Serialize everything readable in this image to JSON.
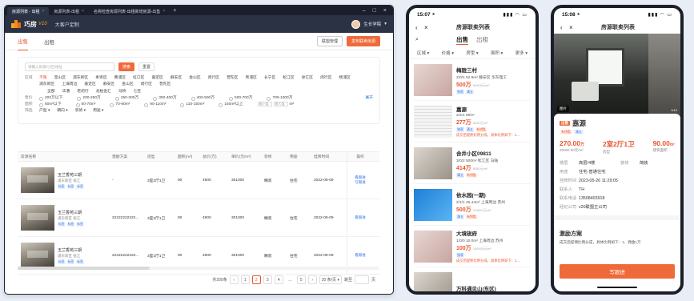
{
  "desktop": {
    "tabs": [
      "房源列表 - 出租",
      "房源列表-出租",
      "名称检查房源列表-出租新增房源-出售"
    ],
    "app_title": "巧房",
    "app_sub": "V10",
    "crumb": "大客户定制",
    "user": "生长学院",
    "page_tabs": [
      "出售",
      "出租"
    ],
    "btn_manage": "联盟管理",
    "btn_publish": "发布联卖房源",
    "search_placeholder": "请输入房源/小区/地址",
    "btn_search": "搜索",
    "btn_reset": "重置",
    "filter_labels": [
      "区域",
      "",
      "",
      "售价",
      "面积",
      "筛选"
    ],
    "districts": [
      "不限",
      "宝山区",
      "浦东新区",
      "奉贤区",
      "黄浦区",
      "虹口区",
      "嘉定区",
      "静安区",
      "金山区",
      "闵行区",
      "普陀区",
      "青浦区",
      "长宁区",
      "松江区",
      "徐汇区",
      "闵行区",
      "杨浦区"
    ],
    "districts2": [
      "浦东新区",
      "上海周边",
      "嘉定区",
      "静安区",
      "金山区",
      "闵行区",
      "普陀区"
    ],
    "sub_areas": [
      "全部",
      "华漕",
      "老闵行",
      "龙柏金汇",
      "马桥",
      "七宝"
    ],
    "prices": [
      "200万以下",
      "200-250万",
      "250-300万",
      "300-400万",
      "400-500万",
      "500-700万",
      "700-1000万"
    ],
    "areas": [
      "50m²以下",
      "50-70m²",
      "70-90m²",
      "90-110m²",
      "110-150m²",
      "150m²以上"
    ],
    "area_min": "最小值",
    "area_max": "最大值",
    "area_unit": "m²",
    "expand": "展开",
    "more_filters": [
      "户型",
      "朝向",
      "装修",
      "用途"
    ],
    "table_headers": [
      "房源名称",
      "激励方案",
      "房型",
      "面积(m²)",
      "总价(万)",
      "单价(元/m²)",
      "装修",
      "用途",
      "挂牌时间",
      "操作"
    ],
    "rows": [
      {
        "name": "玉兰香苑三期",
        "area": "浦东新区 张江",
        "tags": [
          "标签",
          "标签",
          "标签"
        ],
        "incent": "-",
        "layout": "3室2厅1卫",
        "size": "90",
        "total": "4900",
        "unit": "301000",
        "deco": "精装",
        "usage": "住宅",
        "date": "2022-08-09",
        "ops": [
          "看跟进",
          "写跟进"
        ]
      },
      {
        "name": "玉兰香苑三期",
        "area": "浦东新区 张江",
        "tags": [
          "标签",
          "标签",
          "标签"
        ],
        "incent": "22222222222...",
        "layout": "3室2厅1卫",
        "size": "90",
        "total": "4900",
        "unit": "301000",
        "deco": "精装",
        "usage": "住宅",
        "date": "2022-08-09",
        "ops": [
          "看跟进"
        ]
      },
      {
        "name": "玉兰香苑三期",
        "area": "浦东新区 张江",
        "tags": [
          "标签",
          "标签",
          "标签"
        ],
        "incent": "22222222222...",
        "layout": "3室2厅1卫",
        "size": "90",
        "total": "4900",
        "unit": "301000",
        "deco": "精装",
        "usage": "住宅",
        "date": "2022-08-09",
        "ops": [
          "看跟进"
        ]
      }
    ],
    "pager": {
      "total": "共200条",
      "pages": [
        "1",
        "2",
        "3",
        "4",
        "...",
        "5"
      ],
      "active": "2",
      "size": "20 条/页",
      "jump": "跳至",
      "jump_unit": "页"
    }
  },
  "phone1": {
    "time": "15:07",
    "title": "房源联卖列表",
    "tabs": [
      "出售",
      "出租"
    ],
    "filters": [
      "区域",
      "价格",
      "房型",
      "面积",
      "更多"
    ],
    "items": [
      {
        "name": "梅陇三村",
        "spec": "2/0/1  52.9m²  静安区 华东理工",
        "price": "500万",
        "unit": "94408元/m²",
        "tags": [
          "独家",
          "满五"
        ],
        "note": ""
      },
      {
        "name": "嘉源",
        "spec": "2/2/1  90m²",
        "price": "277万",
        "unit": "3030元/m²",
        "tags": [
          "独家",
          "满五",
          "有钥匙"
        ],
        "note": "成交后提佣比例分成，具体比例如下：1..."
      },
      {
        "name": "合井小区09811",
        "spec": "3/0/2  500m²  松江区 马陆",
        "price": "414万",
        "unit": "8280元/m²",
        "tags": [
          "满五",
          "有钥匙"
        ],
        "note": ""
      },
      {
        "name": "依水园(一期)",
        "spec": "2/1/1  45.44m²  上海周边 苏州",
        "price": "500万",
        "unit": "110000元/m²",
        "tags": [
          "满五",
          "有钥匙"
        ],
        "note": ""
      },
      {
        "name": "大境锐府",
        "spec": "1/0/0  10.0m²  上海周边 苏州",
        "price": "100万",
        "unit": "100000元/m²",
        "tags": [
          "独家"
        ],
        "note": "成交后提佣比例分成，具体比例如下：1..."
      },
      {
        "name": "万科通见山(东区)",
        "spec": "",
        "price": "",
        "unit": "",
        "tags": [],
        "note": ""
      }
    ]
  },
  "phone2": {
    "time": "15:08",
    "title": "房源联卖列表",
    "hero_badge": "图片",
    "hero_count": "1/10",
    "badge": "出售",
    "name": "嘉源",
    "tags": [
      "有钥匙",
      "满五"
    ],
    "kpis": [
      {
        "v": "270.00",
        "u": "万",
        "l": "30000.00元/m²"
      },
      {
        "v": "2室2厅1卫",
        "u": "",
        "l": "房型"
      },
      {
        "v": "90.00",
        "u": "m²",
        "l": "建筑面积"
      }
    ],
    "attrs": [
      {
        "k": "楼层",
        "v": "高层/4楼",
        "k2": "装修",
        "v2": "简装"
      },
      {
        "k": "用途",
        "v": "住宅-普通住宅"
      },
      {
        "k": "挂牌时间",
        "v": "2023-05-26 11:29:05"
      },
      {
        "k": "联系人",
        "v": "TH"
      },
      {
        "k": "联系电话",
        "v": "13508403918"
      },
      {
        "k": "经纪公司",
        "v": "v20联盟主公司"
      }
    ],
    "incent_title": "激励方案",
    "incent_desc": "成交后提佣比例分成，具体比例如下：1、佣金1万",
    "cta": "写跟进"
  }
}
